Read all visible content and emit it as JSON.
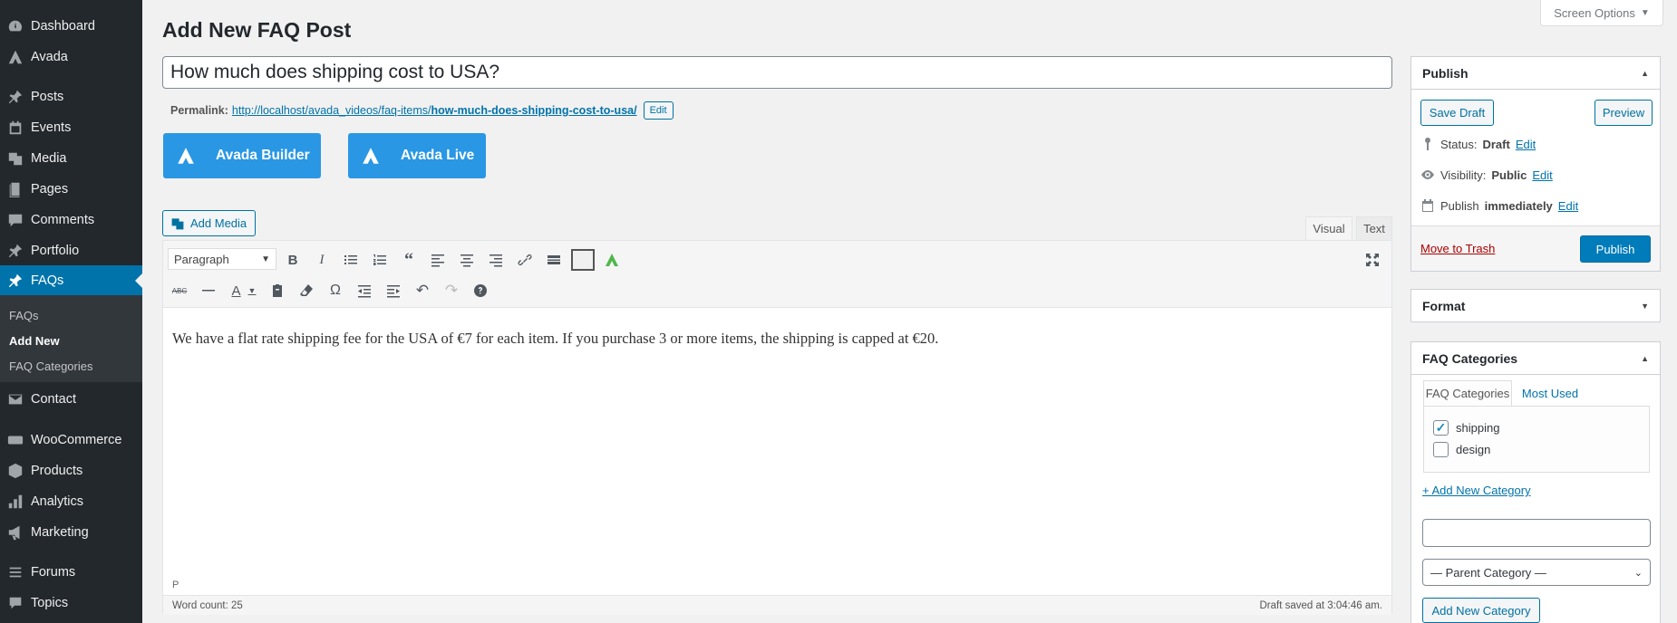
{
  "sidebar": {
    "items": [
      {
        "label": "Dashboard",
        "icon": "dashboard-icon"
      },
      {
        "label": "Avada",
        "icon": "avada-icon"
      },
      {
        "label": "Posts",
        "icon": "pin-icon"
      },
      {
        "label": "Events",
        "icon": "calendar-icon"
      },
      {
        "label": "Media",
        "icon": "media-icon"
      },
      {
        "label": "Pages",
        "icon": "page-icon"
      },
      {
        "label": "Comments",
        "icon": "comment-icon"
      },
      {
        "label": "Portfolio",
        "icon": "pin-icon"
      },
      {
        "label": "FAQs",
        "icon": "pin-icon",
        "active": true
      },
      {
        "label": "Contact",
        "icon": "mail-icon"
      },
      {
        "label": "WooCommerce",
        "icon": "woo-icon"
      },
      {
        "label": "Products",
        "icon": "box-icon"
      },
      {
        "label": "Analytics",
        "icon": "bar-chart-icon"
      },
      {
        "label": "Marketing",
        "icon": "megaphone-icon"
      },
      {
        "label": "Forums",
        "icon": "forum-icon"
      },
      {
        "label": "Topics",
        "icon": "topic-icon"
      }
    ],
    "submenu": [
      "FAQs",
      "Add New",
      "FAQ Categories"
    ]
  },
  "header": {
    "title": "Add New FAQ Post",
    "screen_options": "Screen Options"
  },
  "post": {
    "title": "How much does shipping cost to USA?",
    "permalink_label": "Permalink:",
    "permalink_base": "http://localhost/avada_videos/faq-items/",
    "permalink_slug": "how-much-does-shipping-cost-to-usa/",
    "edit_label": "Edit"
  },
  "builder": {
    "builder_label": "Avada Builder",
    "live_label": "Avada Live"
  },
  "editor": {
    "add_media": "Add Media",
    "tab_visual": "Visual",
    "tab_text": "Text",
    "format": "Paragraph",
    "content": "We have a flat rate shipping fee for the USA of €7 for each item. If you purchase 3 or more items, the shipping is capped at €20.",
    "path": "P",
    "word_count": "Word count: 25",
    "draft_saved": "Draft saved at 3:04:46 am."
  },
  "publish": {
    "heading": "Publish",
    "save_draft": "Save Draft",
    "preview": "Preview",
    "status_label": "Status:",
    "status_value": "Draft",
    "visibility_label": "Visibility:",
    "visibility_value": "Public",
    "publish_label": "Publish",
    "publish_value": "immediately",
    "edit": "Edit",
    "trash": "Move to Trash",
    "publish_button": "Publish"
  },
  "format_box": {
    "heading": "Format"
  },
  "categories": {
    "heading": "FAQ Categories",
    "tab_all": "FAQ Categories",
    "tab_used": "Most Used",
    "items": [
      {
        "label": "shipping",
        "checked": true
      },
      {
        "label": "design",
        "checked": false
      }
    ],
    "add_link": "+ Add New Category",
    "new_name_value": "",
    "parent_select": "— Parent Category —",
    "add_button": "Add New Category"
  },
  "colors": {
    "accent": "#0073aa",
    "sidebar": "#23282d",
    "avada_button": "#2997e4",
    "trash": "#a00000"
  }
}
